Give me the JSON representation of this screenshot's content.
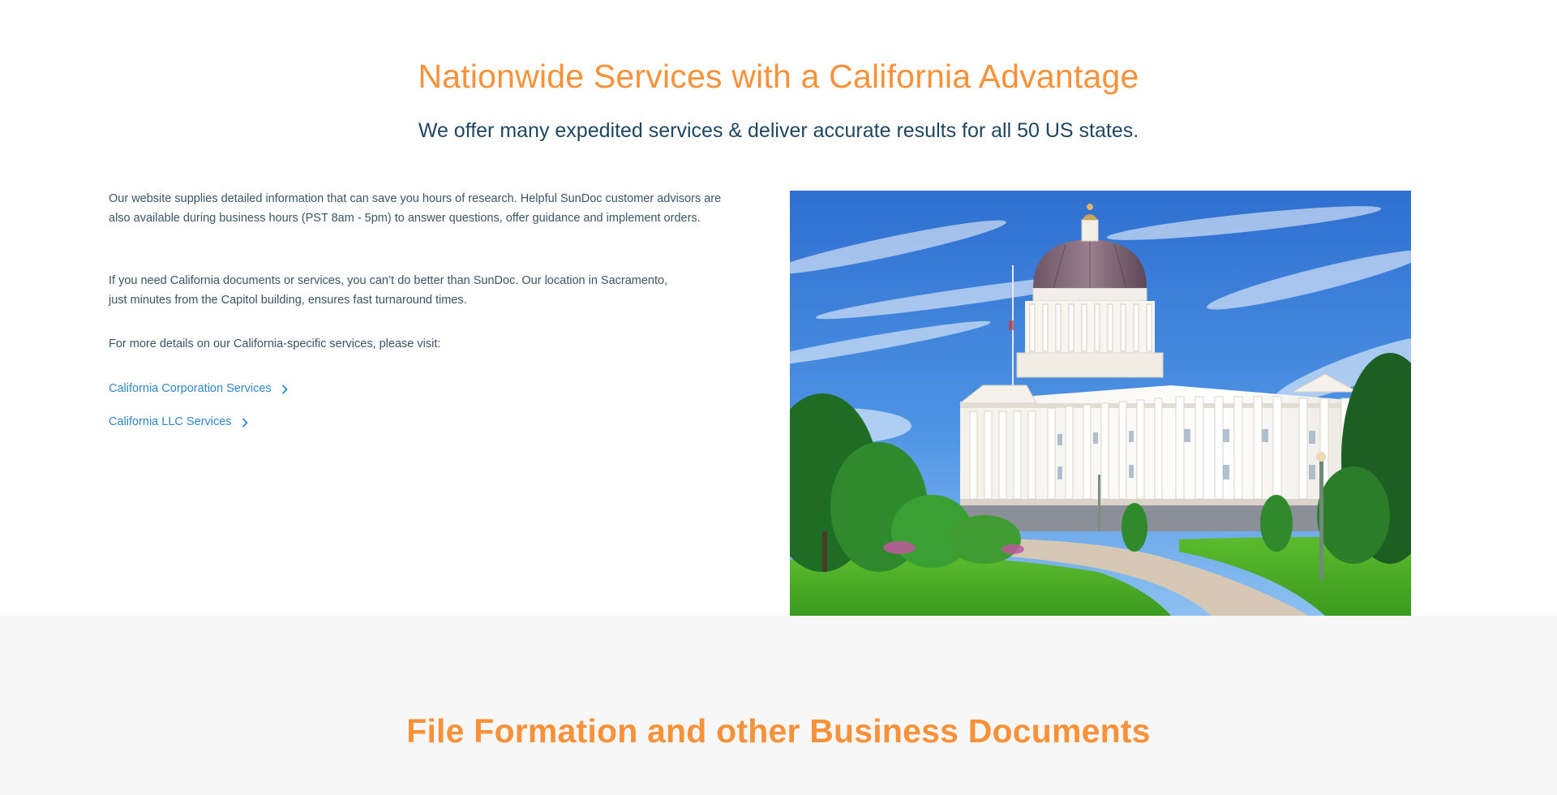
{
  "intro": {
    "title": "Nationwide Services with a California Advantage",
    "subtitle": "We offer many expedited services & deliver accurate results for all 50 US states."
  },
  "body": {
    "paragraph_1": "Our website supplies detailed information that can save you hours of research. Helpful SunDoc customer advisors are also available during business hours (PST 8am - 5pm) to answer questions, offer guidance and implement orders.",
    "paragraph_2": "If you need California documents or services, you can’t do better than SunDoc. Our location in Sacramento, just minutes from the Capitol building, ensures fast turnaround times.",
    "paragraph_3": "For more details on our California-specific services, please visit:",
    "links": [
      {
        "label": "California Corporation Services"
      },
      {
        "label": "California LLC Services"
      }
    ]
  },
  "image": {
    "alt": "California State Capitol building in Sacramento"
  },
  "next_section": {
    "title": "File Formation and other Business Documents"
  },
  "colors": {
    "accent_orange": "#f7913a",
    "navy_text": "#1f4760",
    "body_text": "#3a5565",
    "link_blue": "#2f86c9",
    "section_gray": "#f7f7f7"
  }
}
